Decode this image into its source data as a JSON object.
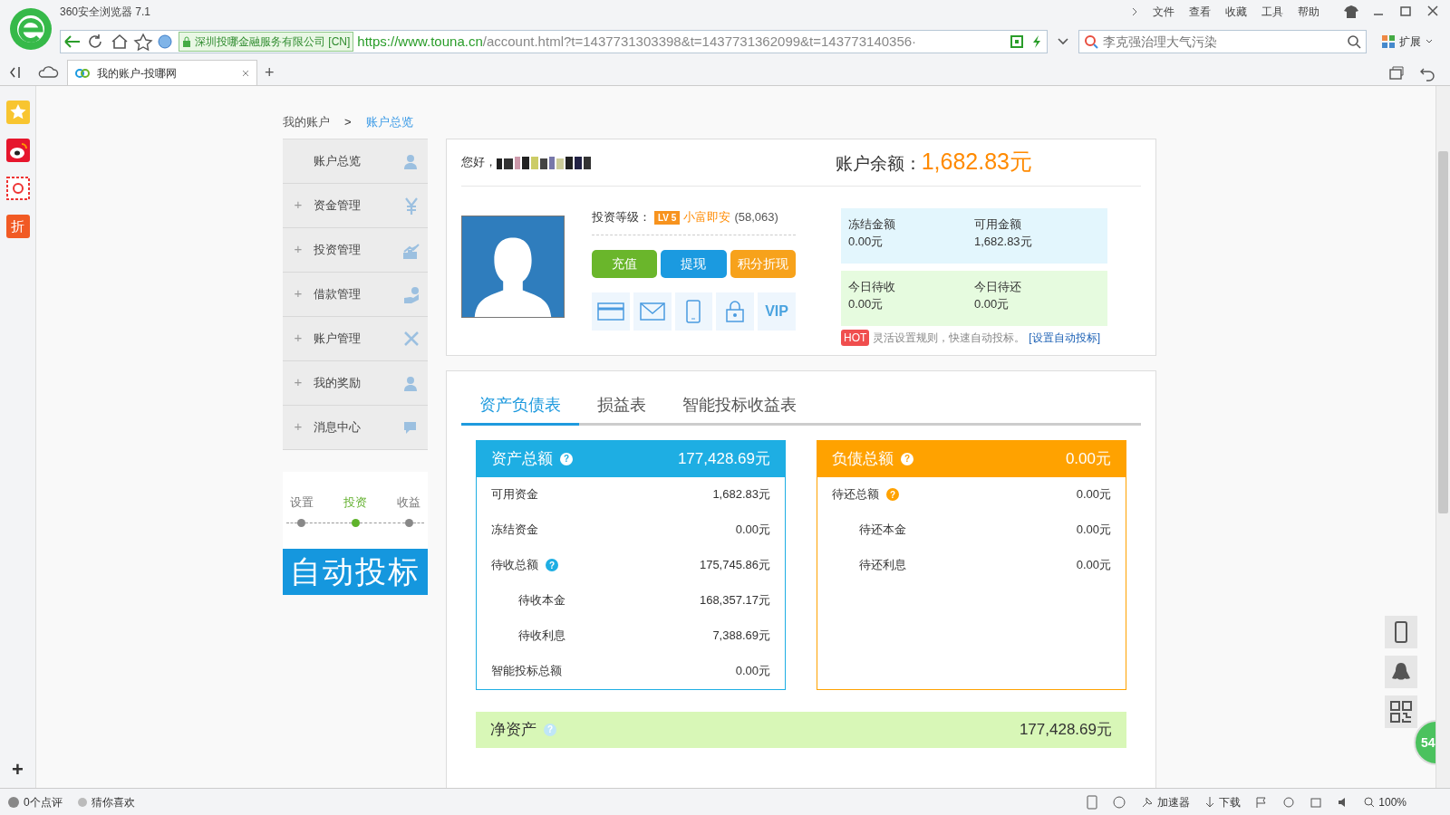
{
  "browser": {
    "title": "360安全浏览器 7.1",
    "menu": [
      "文件",
      "查看",
      "收藏",
      "工具",
      "帮助"
    ],
    "certificate": "深圳投哪金融服务有限公司 [CN]",
    "url_host": "https://www.touna.cn",
    "url_path": "/account.html?t=1437731303398&t=1437731362099&t=143773140356·",
    "search": {
      "placeholder": "李克强治理大气污染"
    },
    "extensions": "扩展",
    "tabs": [
      {
        "label": "我的账户-投哪网",
        "selected": true
      }
    ],
    "sidebar_badge": "折",
    "sidebar_add": "+",
    "status_bar": {
      "reviews": "0个点评",
      "guess": "猜你喜欢",
      "accelerator": "加速器",
      "download": "下载",
      "zoom": "100%"
    }
  },
  "breadcrumb": [
    {
      "label": "我的账户",
      "selected": false
    },
    {
      "label": "账户总览",
      "selected": true
    }
  ],
  "breadcrumb_separator": ">",
  "menu": [
    {
      "label": "账户总览",
      "expandable": false
    },
    {
      "label": "资金管理",
      "expandable": true
    },
    {
      "label": "投资管理",
      "expandable": true
    },
    {
      "label": "借款管理",
      "expandable": true
    },
    {
      "label": "账户管理",
      "expandable": true
    },
    {
      "label": "我的奖励",
      "expandable": true
    },
    {
      "label": "消息中心",
      "expandable": true
    }
  ],
  "menu_expand_sign": "+",
  "auto_bid": {
    "steps": [
      {
        "label": "设置",
        "selected": false
      },
      {
        "label": "投资",
        "selected": true
      },
      {
        "label": "收益",
        "selected": false
      }
    ],
    "banner": "自动投标"
  },
  "account": {
    "greeting": "您好，",
    "balance_label": "账户余额：",
    "balance": "1,682.83元",
    "level_label": "投资等级：",
    "level_badge": "LV 5",
    "level_name": "小富即安",
    "points": "(58,063)",
    "buttons": [
      {
        "label": "充值",
        "color": "#6ab62b"
      },
      {
        "label": "提现",
        "color": "#1b9ae0"
      },
      {
        "label": "积分折现",
        "color": "#f7a21b"
      }
    ],
    "vip": "VIP",
    "stat_groups": [
      {
        "color": "#e3f6fd",
        "items": [
          {
            "label": "冻结金额",
            "value": "0.00元"
          },
          {
            "label": "可用金额",
            "value": "1,682.83元"
          }
        ]
      },
      {
        "color": "#e6fbdf",
        "items": [
          {
            "label": "今日待收",
            "value": "0.00元"
          },
          {
            "label": "今日待还",
            "value": "0.00元"
          }
        ]
      }
    ],
    "hot_badge": "HOT",
    "hot_text": "灵活设置规则，快速自动投标。",
    "hot_link": "[设置自动投标]"
  },
  "report_tabs": [
    {
      "label": "资产负债表",
      "selected": true
    },
    {
      "label": "损益表",
      "selected": false
    },
    {
      "label": "智能投标收益表",
      "selected": false
    }
  ],
  "cards": [
    {
      "title": "资产总额",
      "total": "177,428.69元",
      "color": "#1eaee3",
      "rows": [
        {
          "label": "可用资金",
          "value": "1,682.83元",
          "indent": false,
          "help": false
        },
        {
          "label": "冻结资金",
          "value": "0.00元",
          "indent": false,
          "help": false
        },
        {
          "label": "待收总额",
          "value": "175,745.86元",
          "indent": false,
          "help": true
        },
        {
          "label": "待收本金",
          "value": "168,357.17元",
          "indent": true,
          "help": false
        },
        {
          "label": "待收利息",
          "value": "7,388.69元",
          "indent": true,
          "help": false
        },
        {
          "label": "智能投标总额",
          "value": "0.00元",
          "indent": false,
          "help": false
        }
      ]
    },
    {
      "title": "负债总额",
      "total": "0.00元",
      "color": "#ffa200",
      "rows": [
        {
          "label": "待还总额",
          "value": "0.00元",
          "indent": false,
          "help": true
        },
        {
          "label": "待还本金",
          "value": "0.00元",
          "indent": true,
          "help": false
        },
        {
          "label": "待还利息",
          "value": "0.00元",
          "indent": true,
          "help": false
        }
      ]
    }
  ],
  "net_assets": {
    "label": "净资产",
    "value": "177,428.69元"
  },
  "float_badge": "54",
  "help_sign": "?"
}
